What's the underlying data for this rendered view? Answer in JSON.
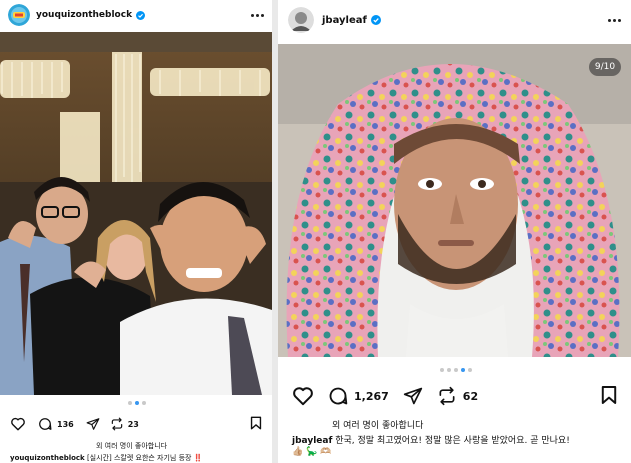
{
  "post_left": {
    "username": "youquizontheblock",
    "like_count": "136",
    "repost_count": "23",
    "liked_by": "외 여러 명이 좋아합니다",
    "caption_username": "youquizontheblock",
    "caption_text": "[실시간] 스칼렛 요한슨 자기님 등장",
    "caption_suffix": "‼️",
    "carousel_total": 3,
    "carousel_active": 1
  },
  "post_right": {
    "username": "jbayleaf",
    "image_counter": "9/10",
    "like_count": "1,267",
    "repost_count": "62",
    "liked_by": "외 여러 명이 좋아합니다",
    "caption_username": "jbayleaf",
    "caption_text": "한국, 정말 최고였어요! 정말 많은 사랑을 받았어요. 곧 만나요!",
    "emoji_line": "👍🏼 🦕 🫶🏼",
    "carousel_total": 5,
    "carousel_active": 4
  },
  "colors": {
    "accent_blue": "#3897f0",
    "verified_blue": "#0095f6",
    "caption_red": "#c43b2b"
  }
}
